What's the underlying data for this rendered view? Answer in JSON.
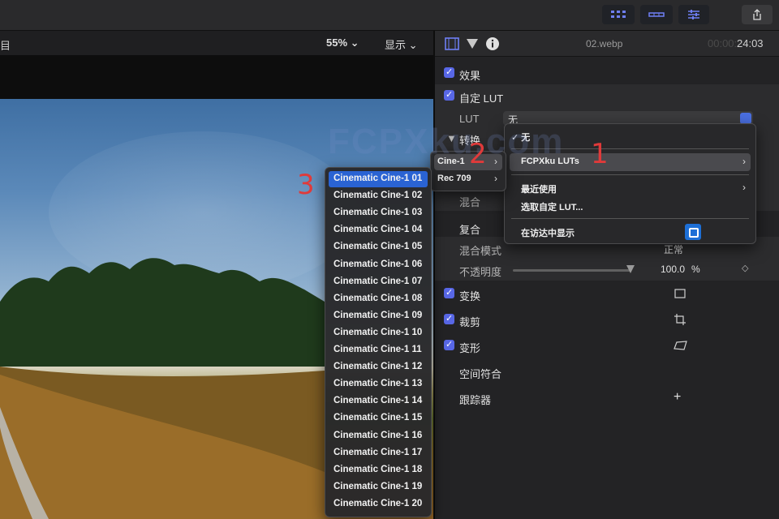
{
  "viewer": {
    "title": "目",
    "zoom": "55%",
    "display": "显示",
    "dropdown_glyph": "⌄"
  },
  "inspector": {
    "filename": "02.webp",
    "time_dim": "00:00:",
    "time": "24:03",
    "rows": {
      "effects": "效果",
      "custom_lut": "自定 LUT",
      "lut_label": "LUT",
      "lut_value": "无",
      "convert": "转换",
      "blend": "混合",
      "composite": "复合",
      "blend_mode": "混合模式",
      "blend_mode_value": "正常",
      "opacity": "不透明度",
      "opacity_value": "100.0",
      "opacity_unit": "%",
      "transform": "变换",
      "crop": "裁剪",
      "distort": "变形",
      "spatial_conform": "空间符合",
      "tracker": "跟踪器",
      "add": "+"
    }
  },
  "lut_menu": {
    "none": "✓ 无",
    "fcpxku_luts": "FCPXku LUTs",
    "recent": "最近使用",
    "choose_custom": "选取自定 LUT...",
    "show_in_finder": "在访达中显示",
    "arrow": "›"
  },
  "sub_menu": {
    "items": [
      "Cine-1",
      "Rec 709"
    ],
    "arrow": "›"
  },
  "cine_menu": {
    "items": [
      "Cinematic Cine-1 01",
      "Cinematic Cine-1 02",
      "Cinematic Cine-1 03",
      "Cinematic Cine-1 04",
      "Cinematic Cine-1 05",
      "Cinematic Cine-1 06",
      "Cinematic Cine-1 07",
      "Cinematic Cine-1 08",
      "Cinematic Cine-1 09",
      "Cinematic Cine-1 10",
      "Cinematic Cine-1 11",
      "Cinematic Cine-1 12",
      "Cinematic Cine-1 13",
      "Cinematic Cine-1 14",
      "Cinematic Cine-1 15",
      "Cinematic Cine-1 16",
      "Cinematic Cine-1 17",
      "Cinematic Cine-1 18",
      "Cinematic Cine-1 19",
      "Cinematic Cine-1 20"
    ]
  },
  "annotations": {
    "step1": "1",
    "step2": "2",
    "step3": "3"
  },
  "watermark": "FCPXku.com",
  "colors": {
    "accent": "#2a63d3",
    "checkbox": "#5867e6",
    "annotation": "#e03a3a"
  }
}
